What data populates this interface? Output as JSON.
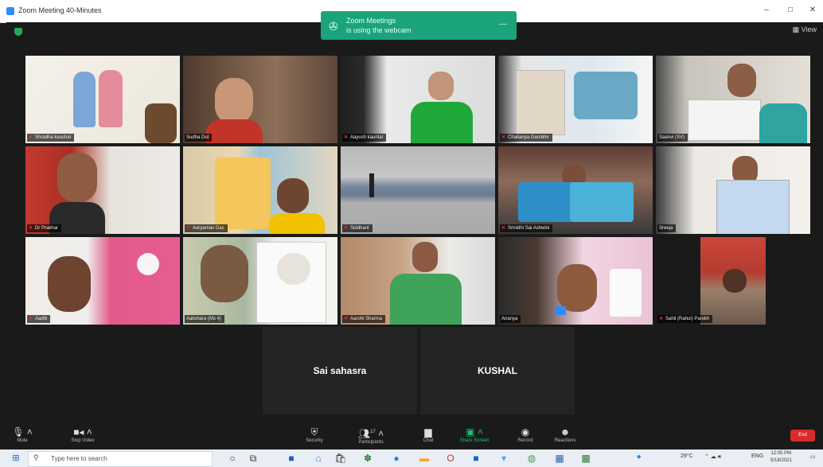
{
  "window": {
    "title": "Zoom Meeting 40-Minutes",
    "minimize": "–",
    "maximize": "□",
    "close": "✕"
  },
  "header": {
    "view_label": "View"
  },
  "notification": {
    "title": "Zoom Meetings",
    "body": "is using the webcam"
  },
  "participants": [
    {
      "name": "Shradha kaushal"
    },
    {
      "name": "Sudha Dut"
    },
    {
      "name": "Aayush kauntal"
    },
    {
      "name": "Chaitanya Gambhir"
    },
    {
      "name": "Saanvi (SV)"
    },
    {
      "name": "Dr Prakhar"
    },
    {
      "name": "Aaryaman Das"
    },
    {
      "name": "Siddhant"
    },
    {
      "name": "Srinidhi Sai Ashwini"
    },
    {
      "name": "Sreeja"
    },
    {
      "name": "Aadhi"
    },
    {
      "name": "Aakshara (Ms 4)"
    },
    {
      "name": "Aarohi Sharma"
    },
    {
      "name": "Ananya"
    },
    {
      "name": "Sahil (Rahul) Parekh"
    }
  ],
  "camera_off": [
    {
      "name": "Sai sahasra"
    },
    {
      "name": "KUSHAL"
    }
  ],
  "toolbar": {
    "mute": "Mute",
    "stop_video": "Stop Video",
    "security": "Security",
    "participants": "Participants",
    "participants_count": "17",
    "chat": "Chat",
    "share_screen": "Share Screen",
    "record": "Record",
    "reactions": "Reactions",
    "end": "End"
  },
  "taskbar": {
    "search_placeholder": "Type here to search",
    "weather": "29°C",
    "lang": "ENG",
    "time": "12:05 PM",
    "date": "5/18/2021"
  },
  "colors": {
    "accent": "#2d8cff",
    "share_green": "#1cc36b",
    "end_red": "#d92b2b",
    "notification": "#1ba37b"
  }
}
